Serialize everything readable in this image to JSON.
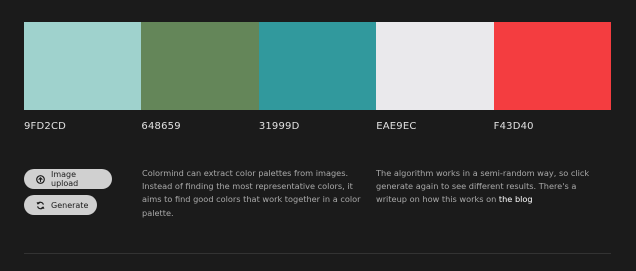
{
  "palette": {
    "swatches": [
      {
        "hex": "9FD2CD",
        "color": "#9FD2CD"
      },
      {
        "hex": "648659",
        "color": "#648659"
      },
      {
        "hex": "31999D",
        "color": "#31999D"
      },
      {
        "hex": "EAE9EC",
        "color": "#EAE9EC"
      },
      {
        "hex": "F43D40",
        "color": "#F43D40"
      }
    ]
  },
  "buttons": {
    "upload_label": "Image upload",
    "upload_icon": "upload-icon",
    "generate_label": "Generate",
    "generate_icon": "refresh-icon"
  },
  "description": {
    "left": "Colormind can extract color palettes from images. Instead of finding the most representative colors, it aims to find good colors that work together in a color palette.",
    "right_prefix": "The algorithm works in a semi-random way, so click generate again to see different results. There's a writeup on how this works on ",
    "right_link": "the blog"
  },
  "colors": {
    "background": "#1b1b1b",
    "button": "#d0d0d0",
    "text": "#a9a9a9",
    "link": "#ffffff"
  }
}
